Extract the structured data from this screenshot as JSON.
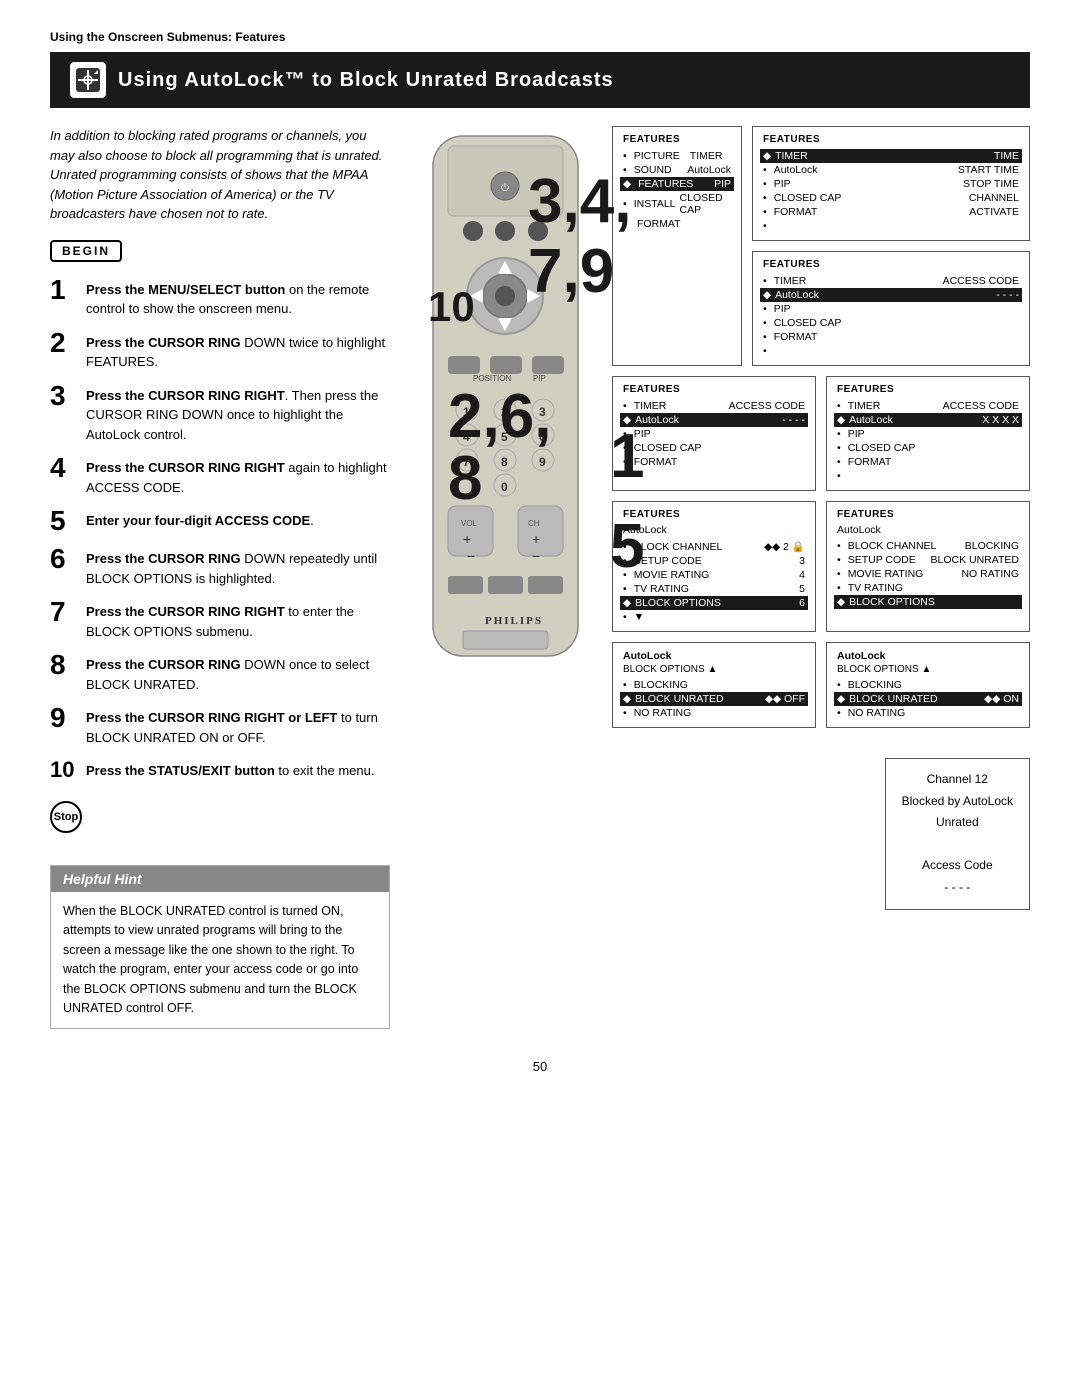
{
  "page": {
    "top_label": "Using the Onscreen Submenus: Features",
    "title": "Using AutoLock™ to Block Unrated Broadcasts",
    "page_number": "50"
  },
  "intro": {
    "text": "In addition to blocking rated programs or channels, you may also choose to block all programming that is unrated. Unrated programming consists of shows that the MPAA (Motion Picture Association of America) or the TV broadcasters have chosen not to rate."
  },
  "begin_label": "BEGIN",
  "stop_label": "Stop",
  "steps": [
    {
      "num": "1",
      "text_bold": "Press the MENU/SELECT button",
      "text_rest": " on the remote control to show the onscreen menu."
    },
    {
      "num": "2",
      "text_bold": "Press the CURSOR RING",
      "text_rest": " DOWN twice to highlight FEATURES."
    },
    {
      "num": "3",
      "text_bold": "Press the CURSOR RING RIGHT",
      "text_rest": ". Then press the CURSOR RING DOWN once to highlight the AutoLock control."
    },
    {
      "num": "4",
      "text_bold": "Press the CURSOR RING RIGHT",
      "text_rest": " again to highlight ACCESS CODE."
    },
    {
      "num": "5",
      "text_bold": "Enter your four-digit ACCESS CODE",
      "text_rest": "."
    },
    {
      "num": "6",
      "text_bold": "Press the CURSOR RING",
      "text_rest": " DOWN repeatedly until BLOCK OPTIONS is highlighted."
    },
    {
      "num": "7",
      "text_bold": "Press the CURSOR RING RIGHT",
      "text_rest": " to enter the BLOCK OPTIONS submenu."
    },
    {
      "num": "8",
      "text_bold": "Press the CURSOR RING",
      "text_rest": " DOWN once to select BLOCK UNRATED."
    },
    {
      "num": "9",
      "text_bold": "Press the CURSOR RING RIGHT or LEFT",
      "text_rest": " to turn BLOCK UNRATED ON or OFF."
    },
    {
      "num": "10",
      "text_bold": "Press the STATUS/EXIT button",
      "text_rest": " to exit the menu."
    }
  ],
  "screens": {
    "top_left": {
      "title": "Features",
      "items": [
        {
          "bullet": "•",
          "label": "PICTURE",
          "sub": "TIMER",
          "indent": 0
        },
        {
          "bullet": "•",
          "label": "SOUND",
          "sub": "AutoLock",
          "indent": 0
        },
        {
          "bullet": "◆",
          "label": "FEATURES",
          "sub": "PIP",
          "indent": 0,
          "selected": true
        },
        {
          "bullet": "•",
          "label": "INSTALL",
          "sub": "CLOSED CAP",
          "indent": 0
        },
        {
          "bullet": "",
          "label": "",
          "sub": "FORMAT",
          "indent": 0
        }
      ]
    },
    "top_right_1": {
      "title": "Features",
      "items": [
        {
          "bullet": "◆",
          "label": "TIMER",
          "sub": "TIME",
          "selected": true
        },
        {
          "bullet": "•",
          "label": "AutoLock",
          "sub": "START TIME"
        },
        {
          "bullet": "•",
          "label": "PIP",
          "sub": "STOP TIME"
        },
        {
          "bullet": "•",
          "label": "CLOSED CAP",
          "sub": "CHANNEL"
        },
        {
          "bullet": "•",
          "label": "FORMAT",
          "sub": "ACTIVATE"
        },
        {
          "bullet": "•",
          "label": ""
        }
      ]
    },
    "top_right_2": {
      "title": "Features",
      "items": [
        {
          "bullet": "•",
          "label": "TIMER",
          "sub": "ACCESS CODE"
        },
        {
          "bullet": "◆",
          "label": "AutoLock",
          "sub": "- - - -",
          "selected": true
        },
        {
          "bullet": "•",
          "label": "PIP"
        },
        {
          "bullet": "•",
          "label": "CLOSED CAP"
        },
        {
          "bullet": "•",
          "label": "FORMAT"
        },
        {
          "bullet": "•",
          "label": ""
        }
      ]
    },
    "mid_left": {
      "title": "Features",
      "items": [
        {
          "bullet": "•",
          "label": "TIMER",
          "sub": "ACCESS CODE"
        },
        {
          "bullet": "◆",
          "label": "AutoLock",
          "sub": "- - - -",
          "selected": false
        },
        {
          "bullet": "•",
          "label": "PIP"
        },
        {
          "bullet": "•",
          "label": "CLOSED CAP"
        },
        {
          "bullet": "•",
          "label": "FORMAT"
        },
        {
          "bullet": "•",
          "label": ""
        }
      ],
      "access_highlighted": true
    },
    "mid_right": {
      "title": "Features",
      "items": [
        {
          "bullet": "•",
          "label": "TIMER",
          "sub": "ACCESS CODE"
        },
        {
          "bullet": "◆",
          "label": "AutoLock",
          "sub": "X X X X",
          "selected": true
        },
        {
          "bullet": "•",
          "label": "PIP"
        },
        {
          "bullet": "•",
          "label": "CLOSED CAP"
        },
        {
          "bullet": "•",
          "label": "FORMAT"
        },
        {
          "bullet": "•",
          "label": ""
        }
      ]
    },
    "bot_left_1": {
      "title": "Features",
      "sub_title": "AutoLock",
      "items": [
        {
          "bullet": "•",
          "label": "BLOCK CHANNEL",
          "val": "◆◆ 2",
          "lock": true
        },
        {
          "bullet": "•",
          "label": "SETUP CODE",
          "val": "3"
        },
        {
          "bullet": "•",
          "label": "MOVIE RATING",
          "val": "4"
        },
        {
          "bullet": "•",
          "label": "TV RATING",
          "val": "5"
        },
        {
          "bullet": "◆",
          "label": "BLOCK OPTIONS",
          "val": "6",
          "selected": true
        }
      ]
    },
    "bot_right_1": {
      "title": "Features",
      "sub_title": "AutoLock",
      "items": [
        {
          "bullet": "•",
          "label": "BLOCK CHANNEL",
          "sub": "BLOCKING"
        },
        {
          "bullet": "•",
          "label": "SETUP CODE",
          "sub": "BLOCK UNRATED"
        },
        {
          "bullet": "•",
          "label": "MOVIE RATING",
          "sub": "NO RATING"
        },
        {
          "bullet": "•",
          "label": "TV RATING"
        },
        {
          "bullet": "◆",
          "label": "BLOCK OPTIONS",
          "selected": true
        }
      ]
    },
    "bot_left_2": {
      "title": "AutoLock",
      "sub_title": "BLOCK OPTIONS",
      "items": [
        {
          "bullet": "•",
          "label": "BLOCKING",
          "arrow": true
        },
        {
          "bullet": "◆",
          "label": "BLOCK UNRATED",
          "val": "◆◆ OFF",
          "selected": true
        },
        {
          "bullet": "•",
          "label": "NO RATING"
        }
      ]
    },
    "bot_right_2": {
      "title": "AutoLock",
      "sub_title": "BLOCK OPTIONS",
      "items": [
        {
          "bullet": "•",
          "label": "BLOCKING",
          "arrow": true
        },
        {
          "bullet": "◆",
          "label": "BLOCK UNRATED",
          "val": "◆◆ ON",
          "selected": true
        },
        {
          "bullet": "•",
          "label": "NO RATING"
        }
      ]
    }
  },
  "helpful_hint": {
    "title": "Helpful Hint",
    "text": "When the BLOCK UNRATED control is turned ON, attempts to view unrated programs will bring to the screen a message like the one shown to the right. To watch the program, enter your access code or go into the BLOCK OPTIONS submenu and turn the BLOCK UNRATED control OFF."
  },
  "channel_blocked": {
    "line1": "Channel 12",
    "line2": "Blocked by AutoLock",
    "line3": "Unrated",
    "line4": "Access Code",
    "line5": "- - - -"
  },
  "philips": "PHILIPS"
}
